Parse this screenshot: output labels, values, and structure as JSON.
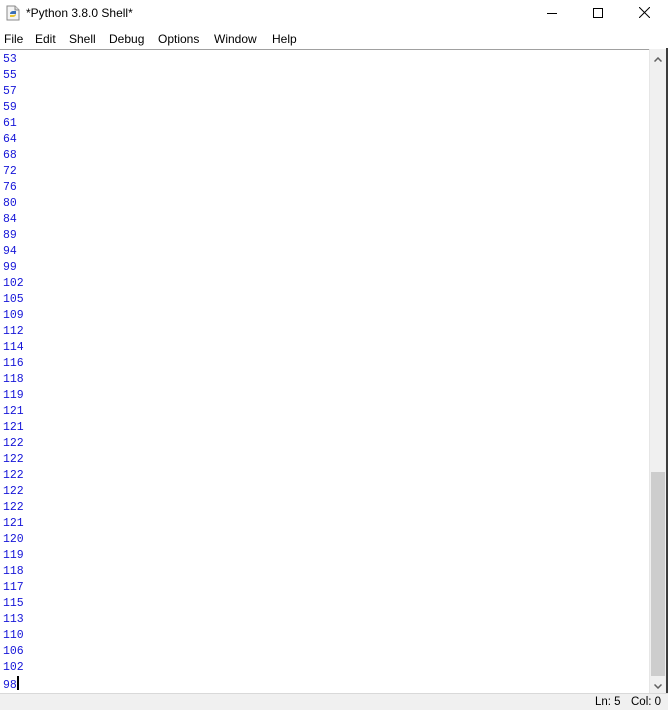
{
  "window": {
    "title": "*Python 3.8.0 Shell*",
    "icon": "python-idle-icon",
    "controls": {
      "minimize_icon": "minimize-icon",
      "maximize_icon": "maximize-icon",
      "close_icon": "close-icon"
    }
  },
  "menubar": {
    "items": [
      "File",
      "Edit",
      "Shell",
      "Debug",
      "Options",
      "Window",
      "Help"
    ]
  },
  "shell": {
    "output_color": "#1515d8",
    "lines": [
      "53",
      "55",
      "57",
      "59",
      "61",
      "64",
      "68",
      "72",
      "76",
      "80",
      "84",
      "89",
      "94",
      "99",
      "102",
      "105",
      "109",
      "112",
      "114",
      "116",
      "118",
      "119",
      "121",
      "121",
      "122",
      "122",
      "122",
      "122",
      "122",
      "121",
      "120",
      "119",
      "118",
      "117",
      "115",
      "113",
      "110",
      "106",
      "102",
      "98"
    ]
  },
  "scrollbar": {
    "up_icon": "chevron-up-icon",
    "down_icon": "chevron-down-icon",
    "position": "bottom"
  },
  "statusbar": {
    "line": "Ln: 5",
    "col": "Col: 0"
  }
}
